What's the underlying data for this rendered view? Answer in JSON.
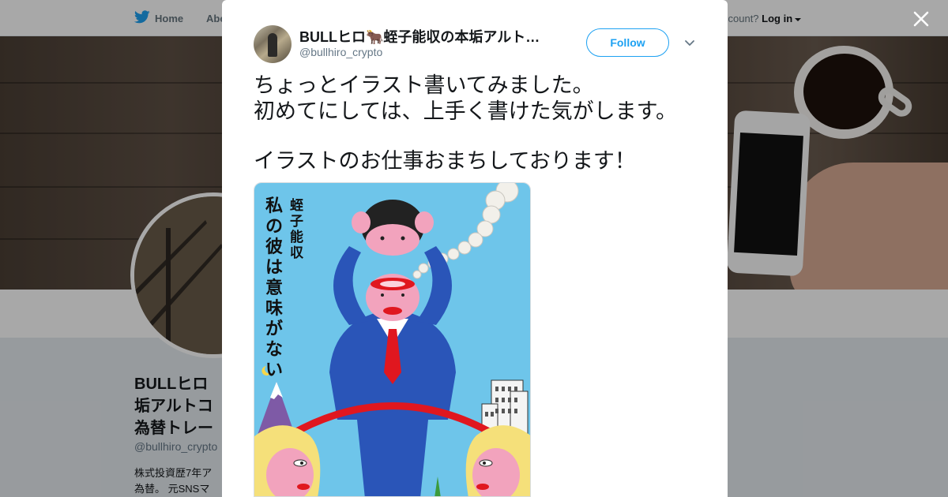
{
  "nav": {
    "home": "Home",
    "about": "Abo",
    "account_prompt": "ccount?",
    "login": "Log in"
  },
  "profile": {
    "name_lines": [
      "BULLヒロ",
      "垢アルトコ",
      "為替トレー"
    ],
    "handle": "@bullhiro_crypto",
    "bio_lines": [
      "株式投資歴7年ア",
      "為替。 元SNSマ"
    ]
  },
  "tweet": {
    "name": "BULLヒロ🐂蛭子能収の本垢アルト…",
    "handle": "@bullhiro_crypto",
    "follow_label": "Follow",
    "text_lines": [
      "ちょっとイラスト書いてみました。",
      "初めてにしては、上手く書けた気がします。",
      "",
      "イラストのお仕事おまちしております！"
    ],
    "image": {
      "title_right": "蛭子能収",
      "title_main": [
        "私",
        "の",
        "彼",
        "は",
        "意",
        "味",
        "が",
        "な",
        "い"
      ]
    }
  },
  "icons": {
    "brand": "twitter-bird-icon",
    "close": "close-icon",
    "more": "chevron-down-icon"
  },
  "colors": {
    "accent": "#1da1f2",
    "text": "#14171a",
    "muted": "#657786",
    "image_bg": "#6ec5ea",
    "suit": "#2a55b8"
  }
}
